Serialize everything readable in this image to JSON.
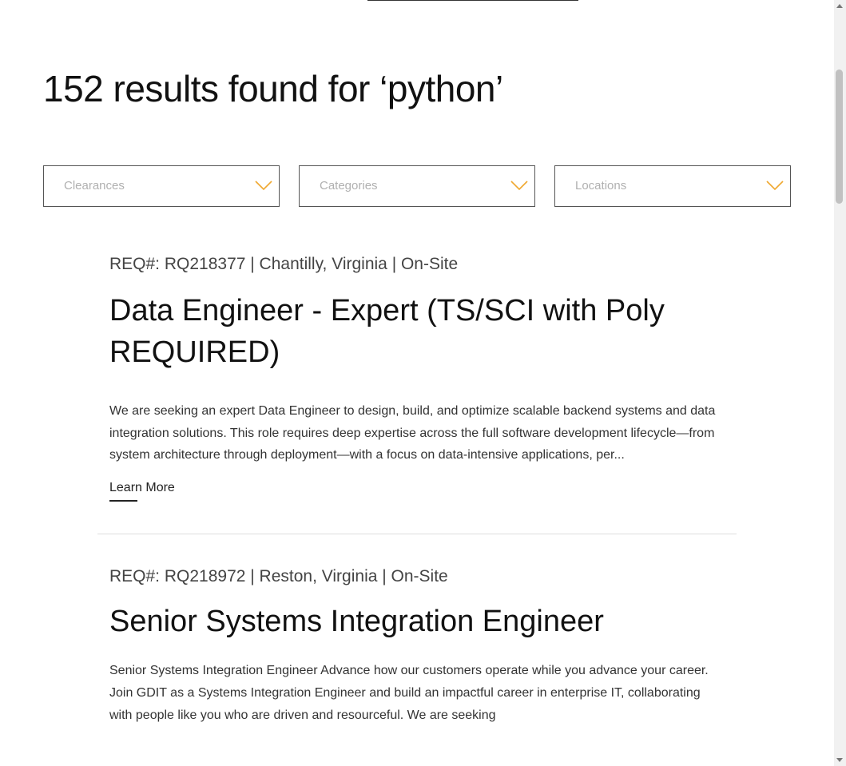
{
  "header": {
    "results_title": "152 results found for ‘python’"
  },
  "filters": [
    {
      "label": "Clearances",
      "icon": "chevron-down-icon"
    },
    {
      "label": "Categories",
      "icon": "chevron-down-icon"
    },
    {
      "label": "Locations",
      "icon": "chevron-down-icon"
    }
  ],
  "colors": {
    "accent": "#f0a830",
    "text": "#111111",
    "placeholder": "#b0b0b0",
    "divider": "#dddddd"
  },
  "jobs": [
    {
      "meta": "REQ#: RQ218377 | Chantilly, Virginia | On-Site",
      "title": "Data Engineer - Expert (TS/SCI with Poly REQUIRED)",
      "description": "We are seeking an expert Data Engineer to design, build, and optimize scalable backend systems and data integration solutions. This role requires deep expertise across the full software development lifecycle—from system architecture through deployment—with a focus on data-intensive applications, per...",
      "link_label": "Learn More"
    },
    {
      "meta": "REQ#: RQ218972 | Reston, Virginia | On-Site",
      "title": "Senior Systems Integration Engineer",
      "description": "Senior Systems Integration Engineer  Advance how our customers operate while you advance your career. Join GDIT as a Systems Integration Engineer and build an impactful career in enterprise IT, collaborating with people like you who are driven and resourceful.  We are seeking"
    }
  ]
}
